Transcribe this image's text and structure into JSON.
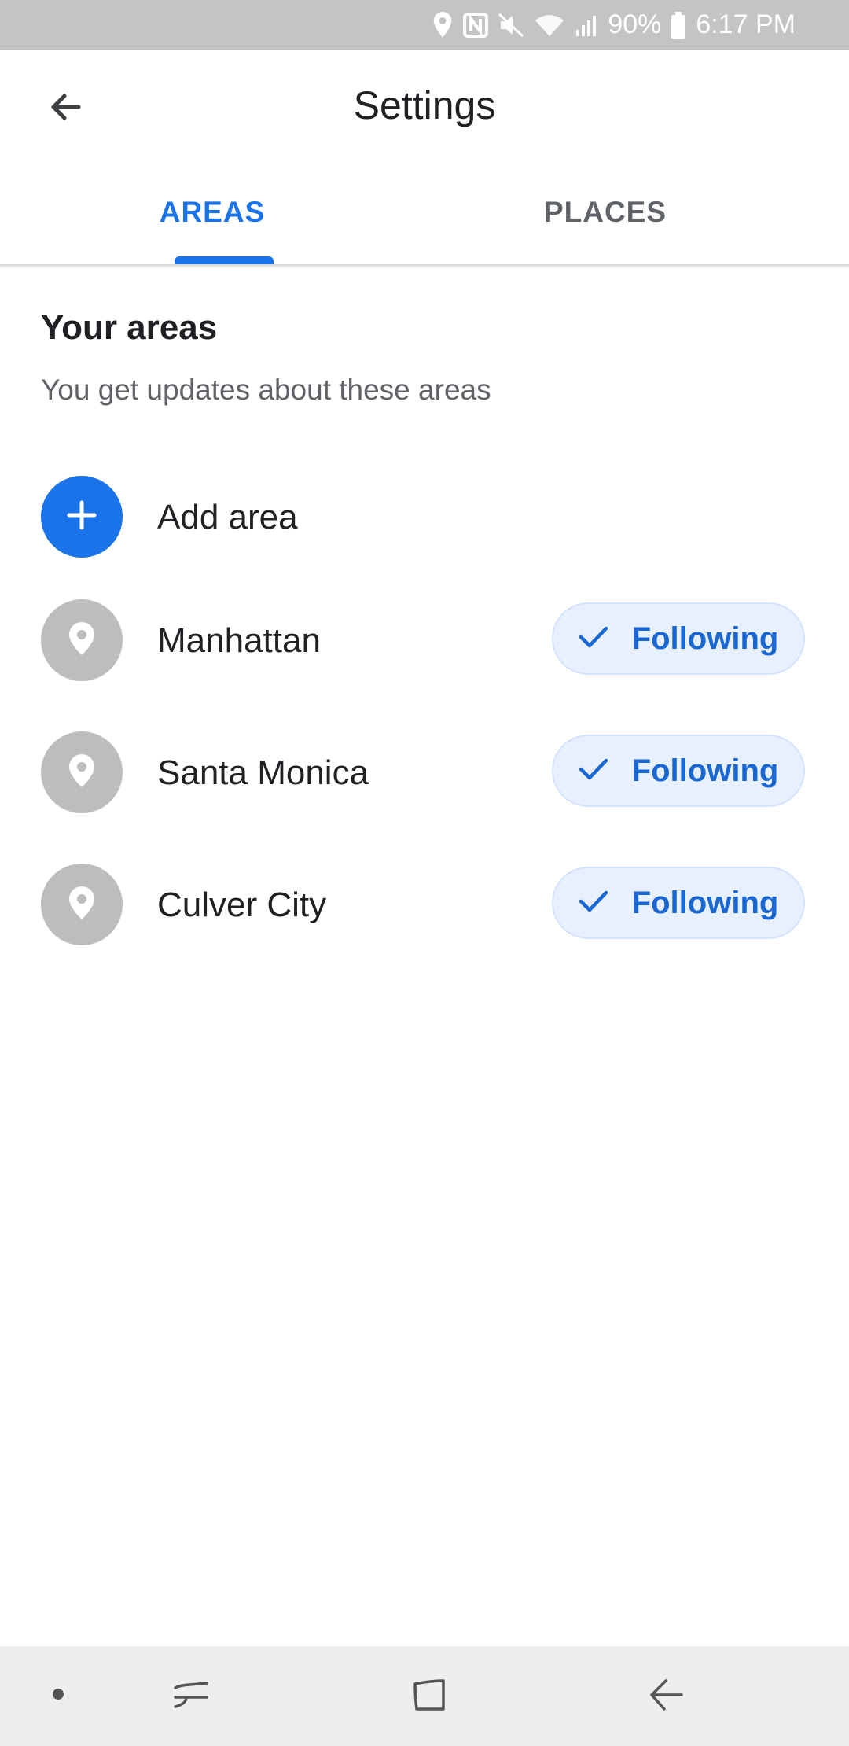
{
  "status_bar": {
    "battery": "90%",
    "time": "6:17 PM",
    "icons": [
      "location-icon",
      "nfc-icon",
      "mute-icon",
      "wifi-icon",
      "signal-icon",
      "battery-icon"
    ]
  },
  "app_bar": {
    "title": "Settings",
    "back_icon": "arrow-back-icon"
  },
  "tabs": [
    {
      "label": "AREAS",
      "selected": true
    },
    {
      "label": "PLACES",
      "selected": false
    }
  ],
  "section": {
    "title": "Your areas",
    "subtitle": "You get updates about these areas"
  },
  "add_area": {
    "label": "Add area",
    "icon": "plus-icon"
  },
  "areas": [
    {
      "name": "Manhattan",
      "follow_label": "Following"
    },
    {
      "name": "Santa Monica",
      "follow_label": "Following"
    },
    {
      "name": "Culver City",
      "follow_label": "Following"
    }
  ],
  "colors": {
    "accent": "#1a73e8",
    "follow_bg": "#e8f0fe",
    "place_icon_bg": "#bdbdbd",
    "status_bar": "#c4c4c4",
    "nav_bar": "#eeeeee"
  },
  "nav_bar": {
    "icons": [
      "dot-icon",
      "recents-icon",
      "home-icon",
      "back-nav-icon"
    ]
  }
}
